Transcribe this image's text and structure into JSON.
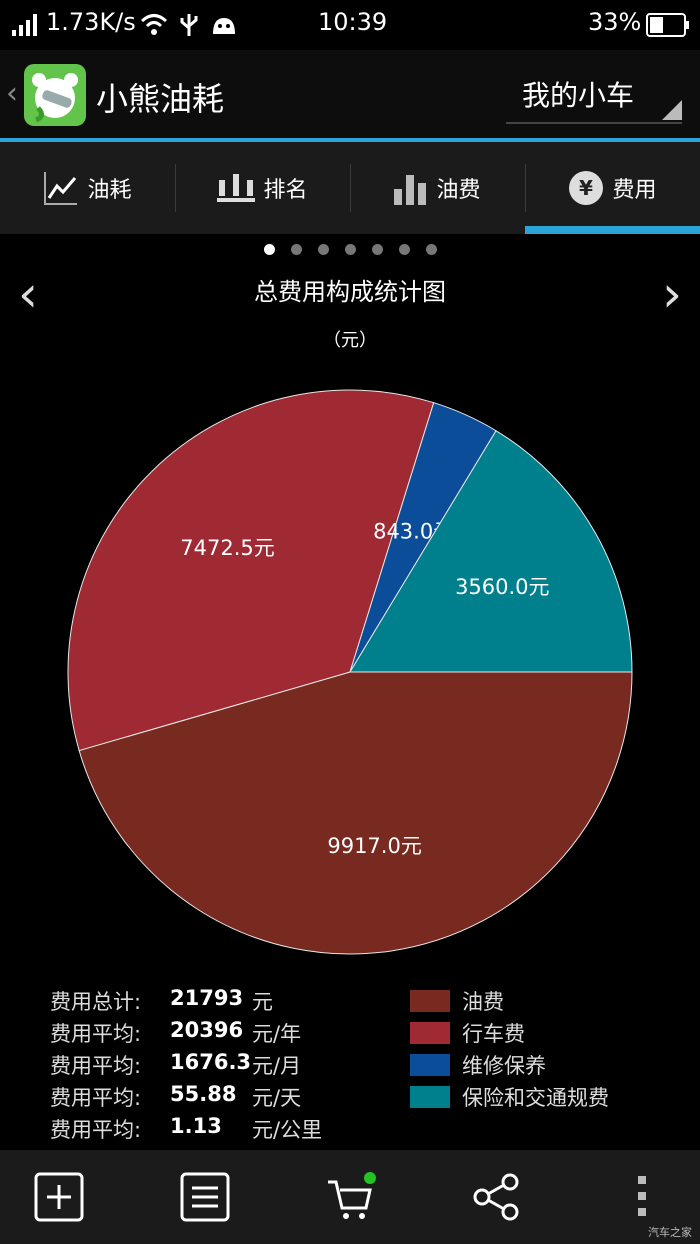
{
  "status": {
    "speed": "1.73K/s",
    "time": "10:39",
    "battery": "33%"
  },
  "app": {
    "title": "小熊油耗",
    "car_selector": "我的小车"
  },
  "tabs": [
    {
      "label": "油耗",
      "icon": "line-chart-icon"
    },
    {
      "label": "排名",
      "icon": "crown-icon"
    },
    {
      "label": "油费",
      "icon": "bar-chart-icon"
    },
    {
      "label": "费用",
      "icon": "yen-icon",
      "active": true
    }
  ],
  "pager": {
    "count": 7,
    "active_index": 0
  },
  "chart_data": {
    "type": "pie",
    "title": "总费用构成统计图",
    "unit_label": "（元）",
    "slices": [
      {
        "name": "油费",
        "value": 9917.0,
        "label": "9917.0元",
        "color": "#782a20"
      },
      {
        "name": "行车费",
        "value": 7472.5,
        "label": "7472.5元",
        "color": "#9f2a33"
      },
      {
        "name": "维修保养",
        "value": 843.0,
        "label": "843.0元",
        "color": "#0b4d98"
      },
      {
        "name": "保险和交通规费",
        "value": 3560.0,
        "label": "3560.0元",
        "color": "#007f8c"
      }
    ]
  },
  "stats": [
    {
      "label": "费用总计:",
      "value": "21793",
      "unit": "元"
    },
    {
      "label": "费用平均:",
      "value": "20396",
      "unit": "元/年"
    },
    {
      "label": "费用平均:",
      "value": "1676.3",
      "unit": "元/月"
    },
    {
      "label": "费用平均:",
      "value": "55.88",
      "unit": "元/天"
    },
    {
      "label": "费用平均:",
      "value": "1.13",
      "unit": "元/公里"
    }
  ],
  "bottom_actions": [
    {
      "icon": "add-icon"
    },
    {
      "icon": "list-icon"
    },
    {
      "icon": "cart-icon",
      "badge_color": "#22c322"
    },
    {
      "icon": "share-icon"
    },
    {
      "icon": "more-icon"
    }
  ],
  "watermark": "汽车之家"
}
